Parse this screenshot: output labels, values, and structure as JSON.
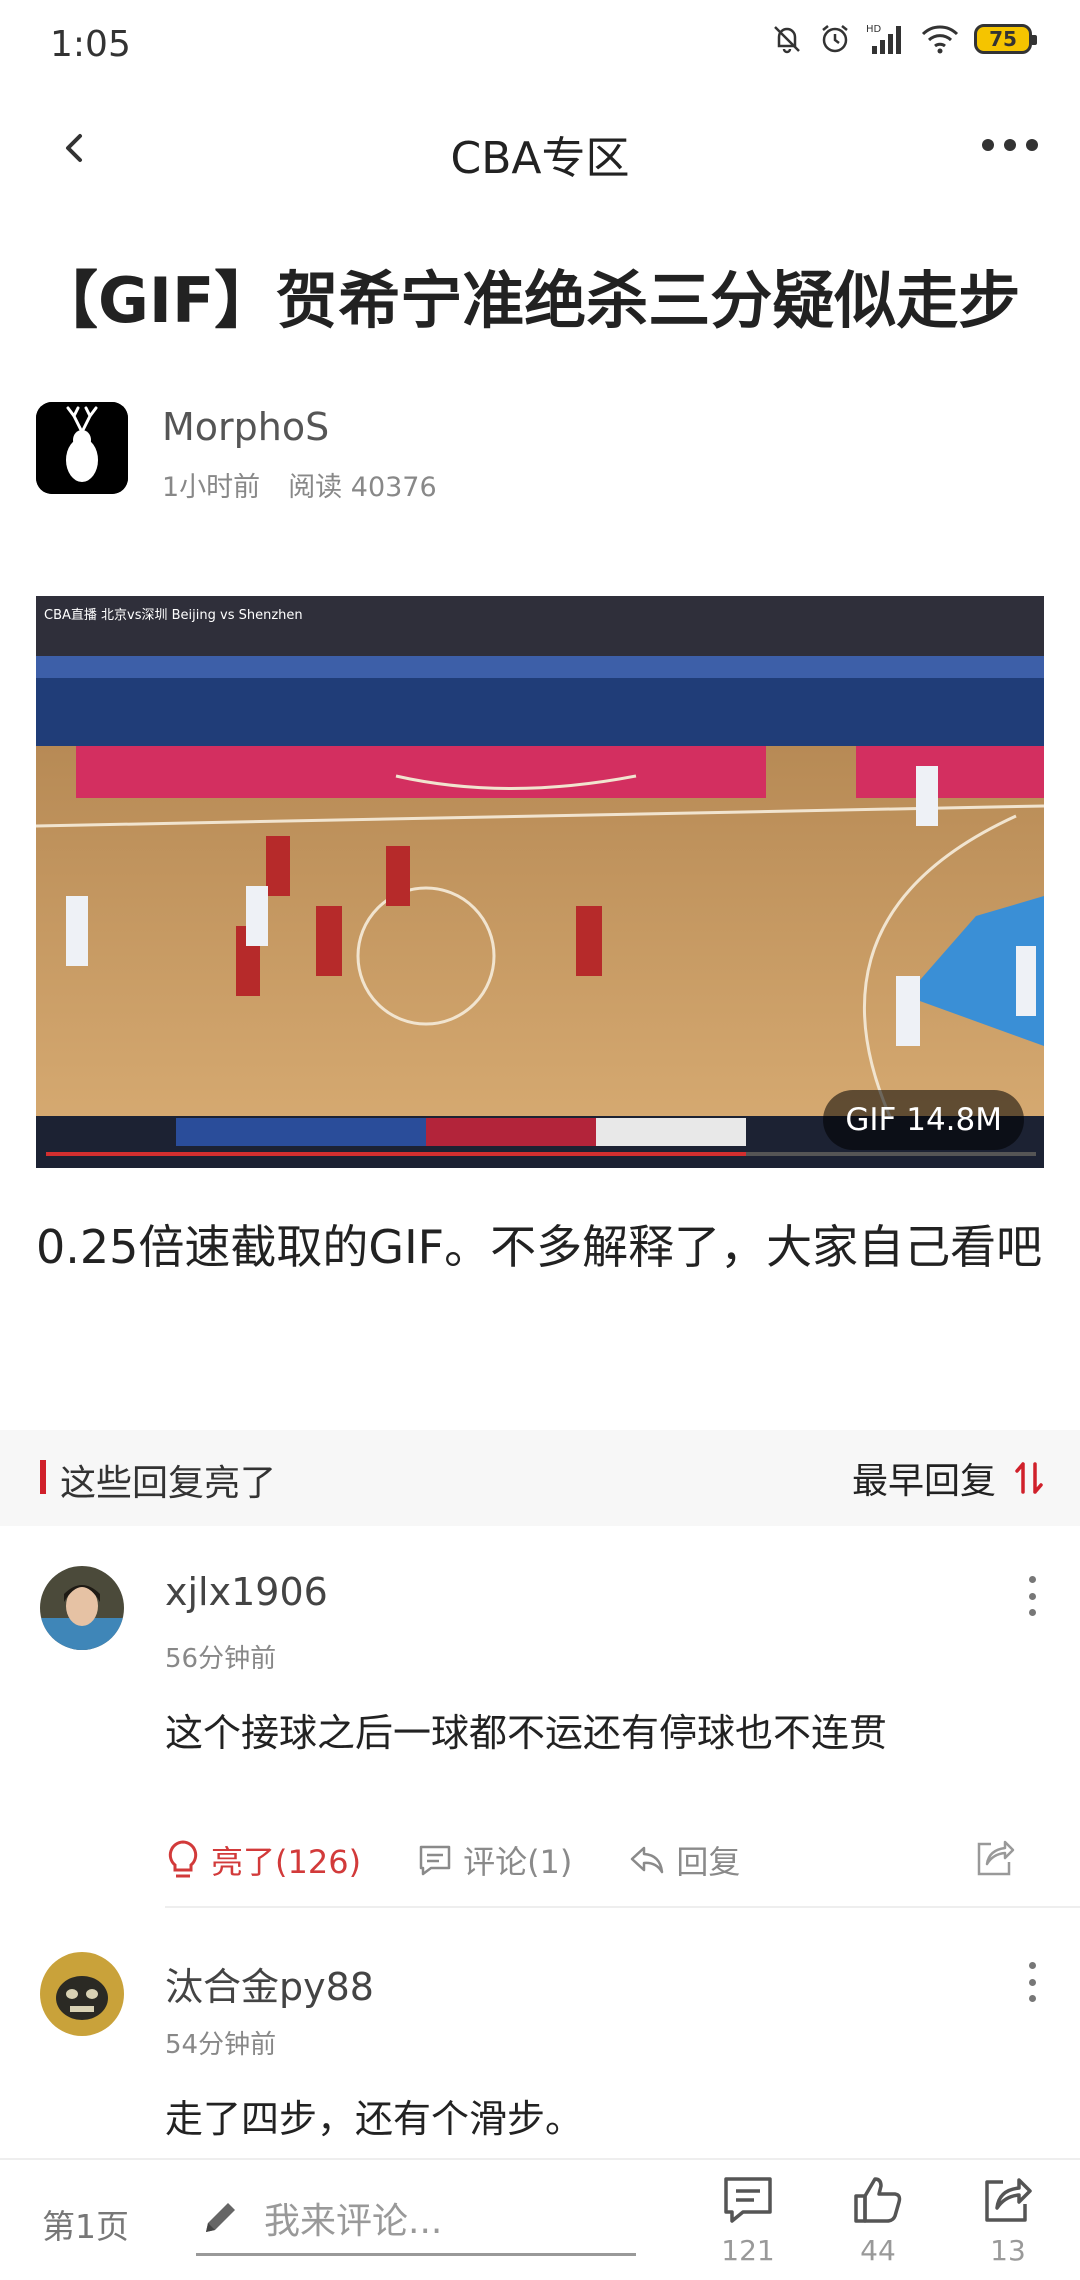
{
  "status": {
    "time": "1:05",
    "battery": "75"
  },
  "nav": {
    "title": "CBA专区"
  },
  "article": {
    "title": "【GIF】贺希宁准绝杀三分疑似走步",
    "author": "MorphoS",
    "time": "1小时前",
    "reads": "阅读 40376",
    "gif_badge": "GIF 14.8M",
    "video_overlay": "CBA直播 北京vs深圳 Beijing vs Shenzhen",
    "description": "0.25倍速截取的GIF。不多解释了，大家自己看吧"
  },
  "section": {
    "title": "这些回复亮了",
    "sort": "最早回复"
  },
  "comments": [
    {
      "user": "xjlx1906",
      "time": "56分钟前",
      "text": "这个接球之后一球都不运还有停球也不连贯",
      "like_label": "亮了(126)",
      "comment_label": "评论(1)",
      "reply_label": "回复"
    },
    {
      "user": "汰合金py88",
      "time": "54分钟前",
      "text": "走了四步，还有个滑步。"
    }
  ],
  "bottom": {
    "page": "第1页",
    "placeholder": "我来评论...",
    "comments_count": "121",
    "likes_count": "44",
    "shares_count": "13"
  },
  "colors": {
    "accent": "#d0202a",
    "like": "#d23a3a"
  }
}
